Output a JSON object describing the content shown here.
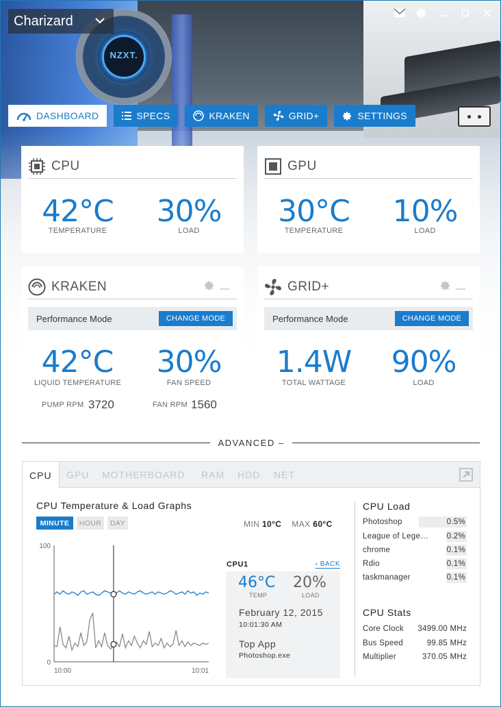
{
  "window": {
    "profile_name": "Charizard",
    "pump_logo": "NZXT."
  },
  "nav": {
    "tabs": [
      {
        "label": "DASHBOARD",
        "icon": "gauge-icon",
        "active": true
      },
      {
        "label": "SPECS",
        "icon": "list-icon",
        "active": false
      },
      {
        "label": "KRAKEN",
        "icon": "kraken-icon",
        "active": false
      },
      {
        "label": "GRID+",
        "icon": "fan-icon",
        "active": false
      },
      {
        "label": "SETTINGS",
        "icon": "gear-icon",
        "active": false
      }
    ]
  },
  "cpu_card": {
    "title": "CPU",
    "temperature": "42°C",
    "temperature_label": "TEMPERATURE",
    "load": "30%",
    "load_label": "LOAD"
  },
  "gpu_card": {
    "title": "GPU",
    "temperature": "30°C",
    "temperature_label": "TEMPERATURE",
    "load": "10%",
    "load_label": "LOAD"
  },
  "kraken_card": {
    "title": "KRAKEN",
    "mode_label": "Performance Mode",
    "change_mode": "CHANGE MODE",
    "liquid_temp": "42°C",
    "liquid_temp_label": "LIQUID TEMPERATURE",
    "fan_speed": "30%",
    "fan_speed_label": "FAN SPEED",
    "pump_rpm_label": "PUMP RPM",
    "pump_rpm": "3720",
    "fan_rpm_label": "FAN RPM",
    "fan_rpm": "1560"
  },
  "grid_card": {
    "title": "GRID+",
    "mode_label": "Performance Mode",
    "change_mode": "CHANGE MODE",
    "wattage": "1.4W",
    "wattage_label": "TOTAL WATTAGE",
    "load": "90%",
    "load_label": "LOAD"
  },
  "advanced": {
    "title": "ADVANCED –",
    "tabs": [
      "CPU",
      "GPU",
      "MOTHERBOARD",
      "RAM",
      "HDD",
      "NET"
    ],
    "active_tab": "CPU",
    "graph_title": "CPU Temperature & Load Graphs",
    "ranges": [
      "MINUTE",
      "HOUR",
      "DAY"
    ],
    "active_range": "MINUTE",
    "min_label": "MIN",
    "min_value": "10°C",
    "max_label": "MAX",
    "max_value": "60°C"
  },
  "chart_data": {
    "type": "line",
    "y_ticks": [
      "100",
      "0"
    ],
    "ylim": [
      0,
      100
    ],
    "x_ticks": [
      "10:00",
      "10:01"
    ],
    "cursor_index": 20,
    "series": [
      {
        "color": "#1a7ccc",
        "values": [
          58,
          60,
          58,
          61,
          59,
          58,
          60,
          59,
          57,
          60,
          61,
          58,
          59,
          60,
          58,
          57,
          59,
          61,
          60,
          59,
          58,
          59,
          61,
          59,
          58,
          60,
          59,
          58,
          60,
          61,
          59,
          58,
          59,
          60,
          58,
          60,
          59,
          58,
          59,
          61,
          60,
          58,
          59,
          60,
          58,
          61,
          59,
          60,
          57,
          59,
          58,
          60,
          59
        ]
      },
      {
        "color": "#888888",
        "values": [
          14,
          13,
          30,
          15,
          12,
          22,
          10,
          16,
          13,
          25,
          14,
          17,
          36,
          42,
          12,
          18,
          13,
          25,
          14,
          11,
          15,
          17,
          13,
          24,
          12,
          18,
          14,
          22,
          16,
          12,
          18,
          15,
          26,
          13,
          16,
          14,
          20,
          12,
          16,
          13,
          15,
          27,
          14,
          18,
          13,
          17,
          14,
          16,
          15,
          14,
          16,
          15,
          16
        ]
      }
    ]
  },
  "cpu1_panel": {
    "title": "CPU1",
    "back": "‹ BACK",
    "temp": "46°C",
    "temp_label": "TEMP",
    "load": "20%",
    "load_label": "LOAD",
    "date": "February 12, 2015",
    "time": "10:01:30 AM",
    "top_app_label": "Top App",
    "top_app": "Photoshop.exe"
  },
  "cpu_load": {
    "title": "CPU Load",
    "rows": [
      {
        "name": "Photoshop",
        "value": "0.5%"
      },
      {
        "name": "League of Legends",
        "value": "0.2%"
      },
      {
        "name": "chrome",
        "value": "0.1%"
      },
      {
        "name": "Rdio",
        "value": "0.1%"
      },
      {
        "name": "taskmanager",
        "value": "0.1%"
      }
    ]
  },
  "cpu_stats": {
    "title": "CPU Stats",
    "rows": [
      {
        "name": "Core Clock",
        "value": "3499.00 MHz"
      },
      {
        "name": "Bus Speed",
        "value": "99.85 MHz"
      },
      {
        "name": "Multiplier",
        "value": "370.05 MHz"
      }
    ]
  },
  "colors": {
    "accent": "#1a7ccc",
    "text": "#333333"
  }
}
